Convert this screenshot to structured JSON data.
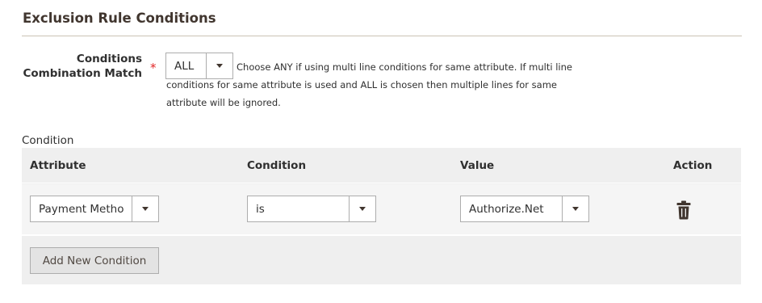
{
  "section": {
    "title": "Exclusion Rule Conditions"
  },
  "combination": {
    "label_line1": "Conditions",
    "label_line2": "Combination Match",
    "required_mark": "*",
    "selected": "ALL",
    "note": "Choose ANY if using multi line conditions for same attribute. If multi line conditions for same attribute is used and ALL is chosen then multiple lines for same attribute will be ignored."
  },
  "grid": {
    "caption": "Condition",
    "headers": {
      "attribute": "Attribute",
      "condition": "Condition",
      "value": "Value",
      "action": "Action"
    },
    "rows": [
      {
        "attribute": "Payment Metho",
        "condition": "is",
        "value": "Authorize.Net",
        "action_icon": "trash-icon"
      }
    ],
    "add_button_label": "Add New Condition"
  },
  "colors": {
    "title": "#41362f",
    "required": "#e22626",
    "grid_background": "#efefef",
    "row_background": "#f5f5f5",
    "border": "#adadad"
  }
}
